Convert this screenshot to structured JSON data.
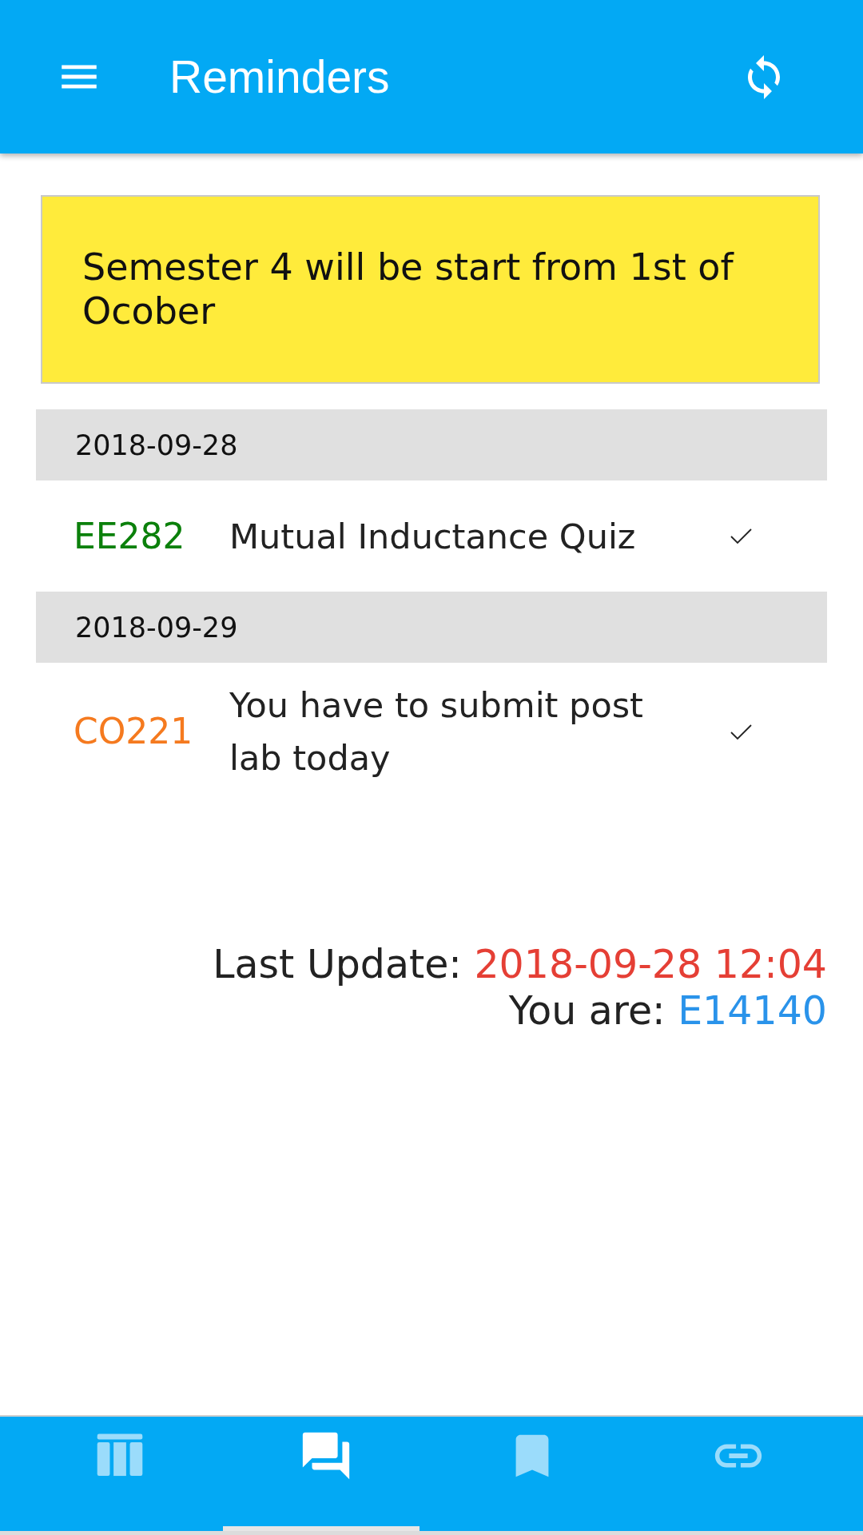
{
  "app_bar": {
    "title": "Reminders"
  },
  "notice": {
    "text": "Semester 4 will be start from 1st of Ocober"
  },
  "groups": [
    {
      "date": "2018-09-28",
      "items": [
        {
          "code": "EE282",
          "color": "#0b800b",
          "title": "Mutual Inductance Quiz"
        }
      ]
    },
    {
      "date": "2018-09-29",
      "items": [
        {
          "code": "CO221",
          "color": "#f57a1f",
          "title": "You have to submit post lab today"
        }
      ]
    }
  ],
  "status": [
    {
      "kind": "time",
      "label": "Last Update:",
      "value": "2018-09-28 12:04"
    },
    {
      "kind": "user",
      "label": "You are:",
      "value": "E14140"
    }
  ],
  "bottom_nav": [
    {
      "kind": "table",
      "selected": false
    },
    {
      "kind": "chat",
      "selected": true
    },
    {
      "kind": "bookmark",
      "selected": false
    },
    {
      "kind": "link",
      "selected": false
    }
  ]
}
